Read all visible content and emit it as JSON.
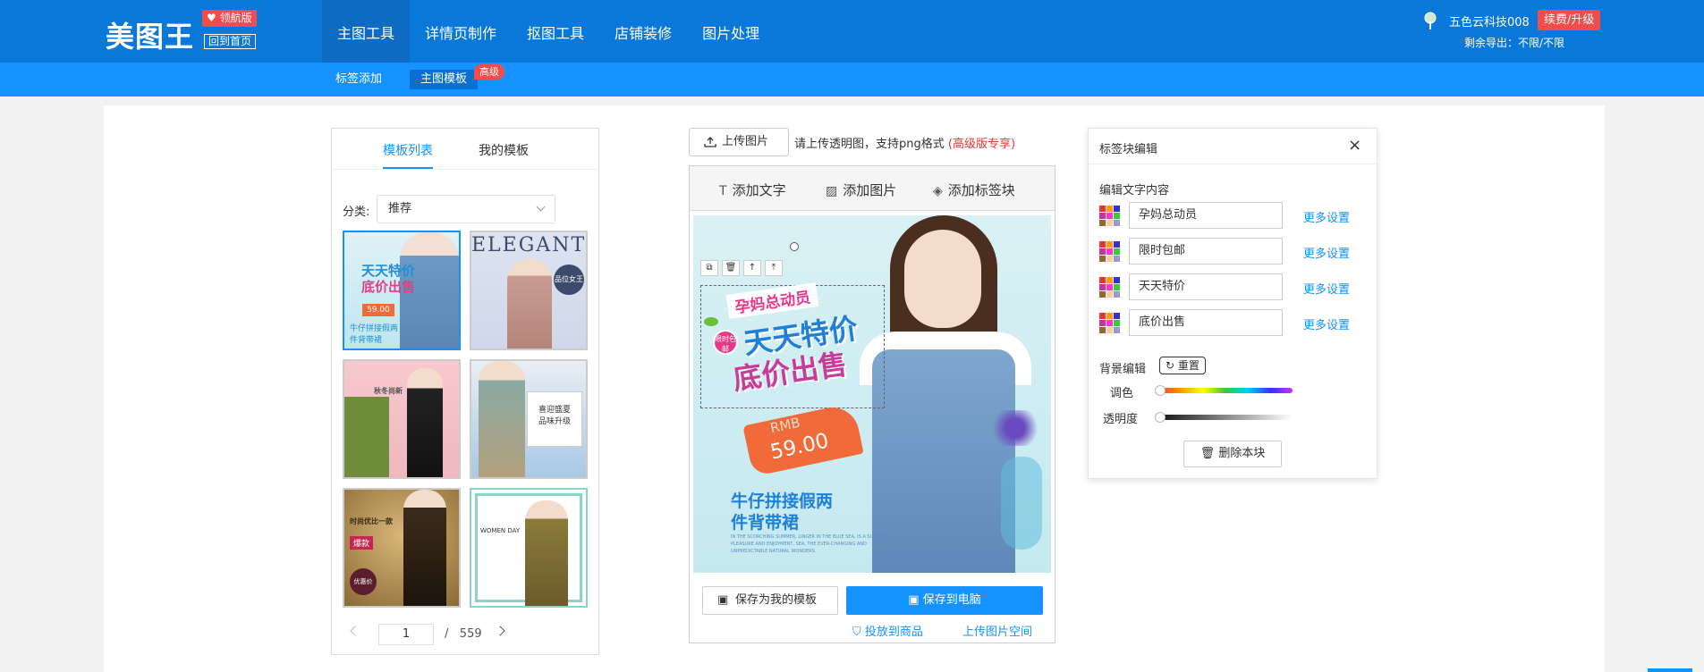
{
  "brand": {
    "logo": "美图王",
    "badge": "领航版",
    "home_link": "回到首页"
  },
  "nav": {
    "items": [
      "主图工具",
      "详情页制作",
      "抠图工具",
      "店铺装修",
      "图片处理"
    ],
    "active": 0
  },
  "user": {
    "name": "五色云科技008",
    "renew_label": "续费/升级",
    "quota": "剩余导出：不限/不限"
  },
  "subnav": {
    "items": [
      "标签添加",
      "主图模板"
    ],
    "active": 1,
    "badge": "高级"
  },
  "left_panel": {
    "tabs": [
      "模板列表",
      "我的模板"
    ],
    "category_label": "分类:",
    "category_value": "推荐",
    "thumbs": [
      {
        "title": "天天特价",
        "sub": "底价出售",
        "price": "59.00",
        "foot": "牛仔拼接假两件背带裙"
      },
      {
        "title": "ELEGANT",
        "sub": "品位女王",
        "foot": ""
      },
      {
        "title": "秋冬尚新",
        "sub": "",
        "foot": ""
      },
      {
        "title": "喜迎盛夏",
        "sub": "品味升级",
        "foot": ""
      },
      {
        "title": "时尚优比一款",
        "sub": "爆款",
        "foot": "优惠价"
      },
      {
        "title": "WOMEN DAY",
        "sub": "",
        "foot": ""
      }
    ],
    "pager": {
      "current": "1",
      "separator": "/",
      "total": "559"
    }
  },
  "center": {
    "upload_label": "上传图片",
    "upload_hint": "请上传透明图，支持png格式",
    "upload_pro": "(高级版专享)",
    "tools": [
      "添加文字",
      "添加图片",
      "添加标签块"
    ],
    "canvas": {
      "tag1": "孕妈总动员",
      "tag2": "天天特价",
      "tag3": "底价出售",
      "badge": "限时包邮",
      "price_label": "RMB",
      "price": "59.00",
      "product": "牛仔拼接假两",
      "product2": "件背带裙",
      "small_text": "IN THE SCORCHING SUMMER, LINGER IN THE BLUE SEA, IS A SUPREME PLEASURE AND ENJOYMENT, SEA, THE EVER-CHANGING AND UNPREDICTABLE NATURAL WONDERS."
    },
    "save_template_label": "保存为我的模板",
    "save_pc_label": "保存到电脑",
    "to_product_label": "投放到商品",
    "upload_space_label": "上传图片空间"
  },
  "right_panel": {
    "title": "标签块编辑",
    "section": "编辑文字内容",
    "rows": [
      {
        "text": "孕妈总动员",
        "more": "更多设置"
      },
      {
        "text": "限时包邮",
        "more": "更多设置"
      },
      {
        "text": "天天特价",
        "more": "更多设置"
      },
      {
        "text": "底价出售",
        "more": "更多设置"
      }
    ],
    "bg_label": "背景编辑",
    "reset_label": "重置",
    "hue_label": "调色",
    "opacity_label": "透明度",
    "hue_value": 0,
    "opacity_value": 0,
    "delete_label": "删除本块"
  },
  "colors": {
    "primary": "#1592ff",
    "topbar": "#0a78d8",
    "danger": "#f44b4b"
  }
}
